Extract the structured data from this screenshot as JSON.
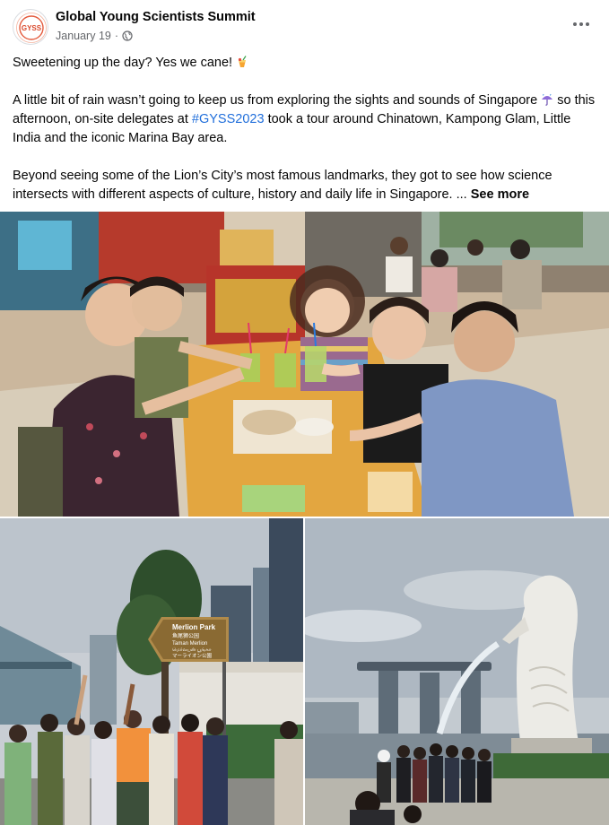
{
  "post": {
    "page_name": "Global Young Scientists Summit",
    "date": "January 19",
    "date_separator": "·",
    "avatar_logo_text": "GYSS",
    "privacy_icon": "globe-icon",
    "more_icon": "more-options-icon"
  },
  "content": {
    "line1": "Sweetening up the day? Yes we cane!",
    "line1_emoji": "tropical-drink-icon",
    "para2_part1": "A little bit of rain wasn’t going to keep us from exploring the sights and sounds of Singapore",
    "para2_emoji": "umbrella-rain-icon",
    "para2_part2": "so this afternoon, on-site delegates at",
    "hashtag": "#GYSS2023",
    "para2_part3": "took a tour around Chinatown, Kampong Glam, Little India and the iconic Marina Bay area.",
    "para3": "Beyond seeing some of the Lion’s City’s most famous landmarks, they got to see how science intersects with different aspects of culture, history and daily life in Singapore.",
    "ellipsis": "...",
    "see_more": "See more"
  },
  "photos": {
    "sign_line1": "Merlion Park",
    "sign_line2": "鱼尾狮公园",
    "sign_line3": "Taman Merlion",
    "sign_line4": "மெர்லயன் பூங்கா",
    "sign_line5": "マーライオン公園"
  },
  "colors": {
    "link": "#216fdb",
    "secondary_text": "#65676b",
    "primary_text": "#050505"
  }
}
